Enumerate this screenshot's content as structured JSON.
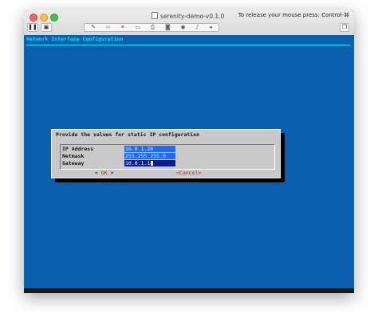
{
  "window": {
    "title": "serenity-demo-v0.1.0",
    "release_hint": "To release your mouse press: Control-⌘"
  },
  "toolbar": {
    "pause_icon": "pause-icon",
    "snapshot_icon": "snapshot-icon",
    "group_icons": [
      "wrench-icon",
      "code-icon",
      "usb-icon",
      "disk-icon",
      "printer-icon",
      "lock-icon",
      "cd-icon",
      "sound-icon",
      "play-icon"
    ],
    "restore_icon": "window-restore-icon"
  },
  "terminal": {
    "header": "Network Interface Configuration",
    "background": "#0b5fb1",
    "accent": "#00e8ff"
  },
  "dialog": {
    "title": "Provide the values for static IP configuration",
    "fields": [
      {
        "label": "IP Address",
        "value": "10.0.1.20"
      },
      {
        "label": "Netmask",
        "value": "255.255.255.0"
      },
      {
        "label": "Gateway",
        "value": "10.0.1.1"
      }
    ],
    "ok_open": "<",
    "ok_label": "OK",
    "ok_close": ">",
    "cancel_label": "<Cancel>"
  }
}
